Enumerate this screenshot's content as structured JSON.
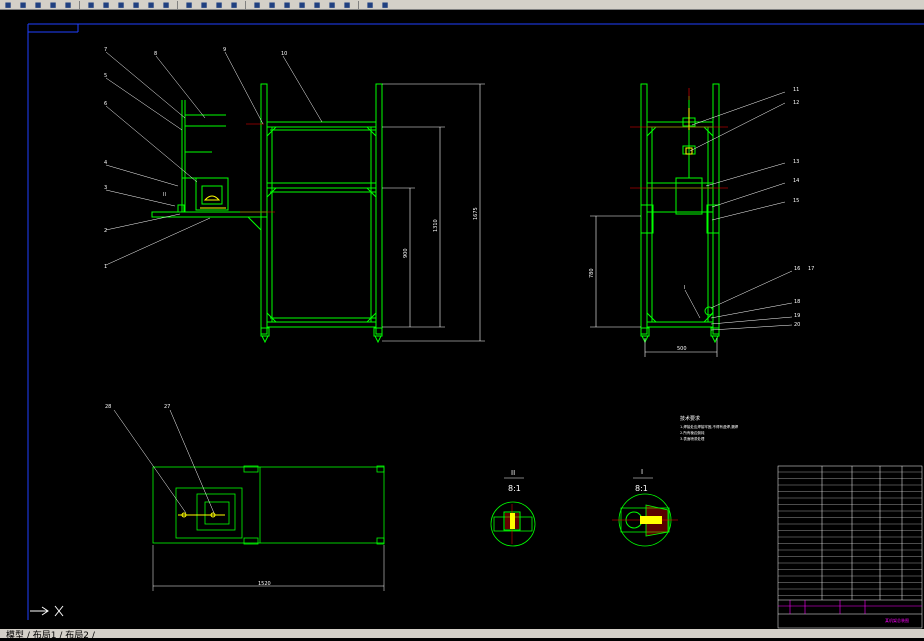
{
  "toolbar": {
    "buttons": [
      "save-icon",
      "open-icon",
      "print-icon",
      "preview-icon",
      "publish-icon",
      "cut-icon",
      "copy-icon",
      "paste-icon",
      "matchprop-icon",
      "undo-icon",
      "redo-icon",
      "pan-icon",
      "zoom-realtime-icon",
      "zoom-window-icon",
      "zoom-previous-icon",
      "properties-icon",
      "designcenter-icon",
      "toolpalette-icon",
      "sheetset-icon",
      "markup-icon",
      "calc-icon",
      "help-icon",
      "layer-icon",
      "layer-state-icon"
    ]
  },
  "drawing": {
    "front_view": {
      "callouts": [
        "7",
        "8",
        "9",
        "10",
        "5",
        "6",
        "4",
        "3",
        "2",
        "1"
      ],
      "dims": {
        "d1": "900",
        "d2": "1310",
        "d3": "1675"
      }
    },
    "side_view": {
      "callouts": [
        "11",
        "12",
        "13",
        "14",
        "15",
        "16",
        "17",
        "18",
        "19",
        "20"
      ],
      "dims": {
        "height": "780",
        "width": "500"
      },
      "detail_marker": "I"
    },
    "top_view": {
      "callouts": [
        "28",
        "27"
      ],
      "dim_width": "1520"
    },
    "detail_ii": {
      "label": "II",
      "scale": "8:1"
    },
    "detail_i": {
      "label": "I",
      "scale": "8:1"
    },
    "notes": {
      "title": "技术要求",
      "lines": [
        "1.焊接处应焊接牢固,不得有虚焊,漏焊",
        "2.所有棱边倒钝",
        "3.表面喷漆处理"
      ]
    },
    "title_block": {
      "drawing_name": "某机架总装图"
    }
  },
  "status": {
    "layout_tabs": "模型 / 布局1 / 布局2 /"
  },
  "colors": {
    "frame": "#00ff00",
    "callout": "#ffffff",
    "dimension": "#ffffff",
    "centerline": "#ff0000",
    "title_block_magenta": "#ff00ff",
    "border_blue": "#2040ff"
  }
}
